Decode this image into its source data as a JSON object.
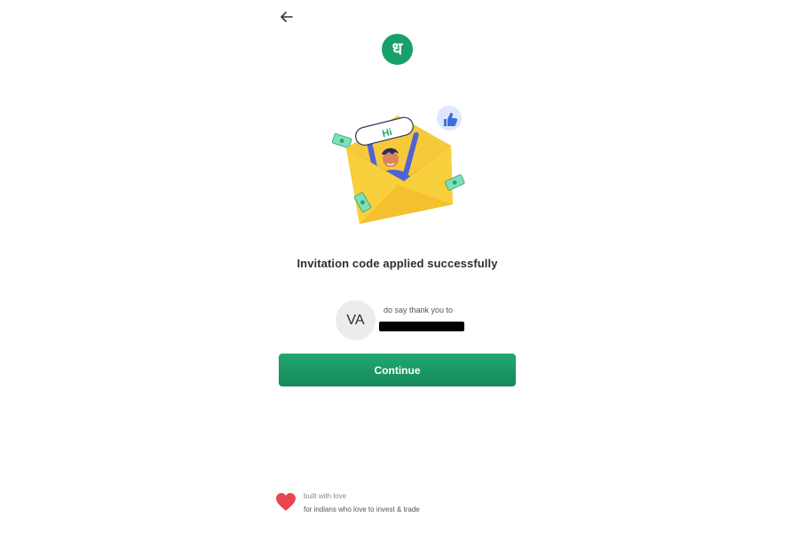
{
  "colors": {
    "brand": "#17a06a",
    "button": "#1a9a66",
    "heart": "#e8464e",
    "envelope": "#f8cf3c",
    "thumbs_badge": "#dde8fb"
  },
  "header": {
    "back_icon": "arrow-left-icon",
    "logo_glyph": "ध"
  },
  "illustration": {
    "sign_text": "Hi",
    "icons": [
      "envelope-icon",
      "thumbs-up-icon",
      "money-icon"
    ]
  },
  "main": {
    "title": "Invitation code applied successfully",
    "referrer": {
      "initials": "VA",
      "label": "do say thank you to"
    },
    "continue_label": "Continue"
  },
  "footer": {
    "icon": "heart-icon",
    "line1": "built with love",
    "line2": "for indians who love to invest & trade"
  }
}
